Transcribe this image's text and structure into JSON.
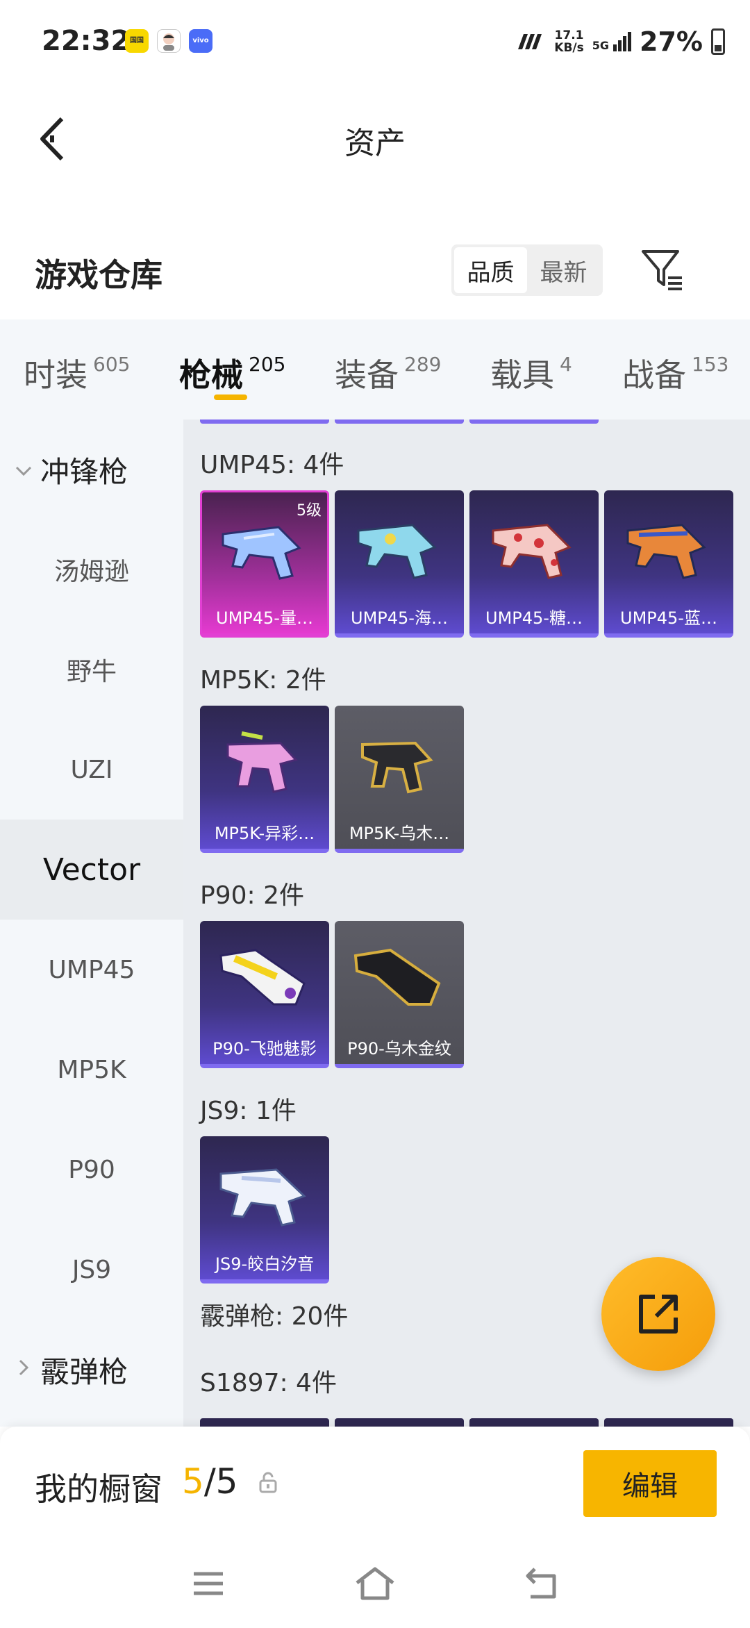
{
  "status_bar": {
    "time": "22:32",
    "apps": [
      {
        "name": "app-icon-1",
        "label": "国国",
        "color": "#f8d800"
      },
      {
        "name": "app-icon-2",
        "label": "",
        "color": "#ffffff"
      },
      {
        "name": "app-icon-3",
        "label": "vivo",
        "color": "#4a6cf7"
      }
    ],
    "speed_value": "17.1",
    "speed_unit": "KB/s",
    "network": "5G",
    "battery": "27%"
  },
  "header": {
    "title": "资产"
  },
  "warehouse": {
    "title": "游戏仓库",
    "sort_options": [
      "品质",
      "最新"
    ]
  },
  "tabs": [
    {
      "label": "时装",
      "count": "605"
    },
    {
      "label": "枪械",
      "count": "205"
    },
    {
      "label": "装备",
      "count": "289"
    },
    {
      "label": "载具",
      "count": "4"
    },
    {
      "label": "战备",
      "count": "153"
    }
  ],
  "sidebar": {
    "group_open": "冲锋枪",
    "items": [
      "汤姆逊",
      "野牛",
      "UZI",
      "Vector",
      "UMP45",
      "MP5K",
      "P90",
      "JS9"
    ],
    "selected": "Vector",
    "group_closed": "霰弹枪"
  },
  "sections": [
    {
      "title": "UMP45: 4件",
      "cards": [
        {
          "label": "UMP45-量…",
          "style": "pink",
          "level": "5级"
        },
        {
          "label": "UMP45-海…",
          "style": "purple"
        },
        {
          "label": "UMP45-糖…",
          "style": "purple"
        },
        {
          "label": "UMP45-蓝…",
          "style": "purple"
        }
      ]
    },
    {
      "title": "MP5K: 2件",
      "cards": [
        {
          "label": "MP5K-异彩…",
          "style": "purple"
        },
        {
          "label": "MP5K-乌木…",
          "style": "gray"
        }
      ]
    },
    {
      "title": "P90: 2件",
      "cards": [
        {
          "label": "P90-飞驰魅影",
          "style": "purple"
        },
        {
          "label": "P90-乌木金纹",
          "style": "gray"
        }
      ]
    },
    {
      "title": "JS9: 1件",
      "cards": [
        {
          "label": "JS9-皎白汐音",
          "style": "purple"
        }
      ]
    }
  ],
  "shotgun_header": "霰弹枪: 20件",
  "s1897_header": "S1897: 4件",
  "showcase": {
    "title": "我的橱窗",
    "current": "5",
    "total": "/5",
    "edit_label": "编辑"
  },
  "colors": {
    "accent": "#f5b400",
    "card_purple": "#3f3481",
    "card_pink": "#e23fd3",
    "card_gray": "#55555d"
  }
}
